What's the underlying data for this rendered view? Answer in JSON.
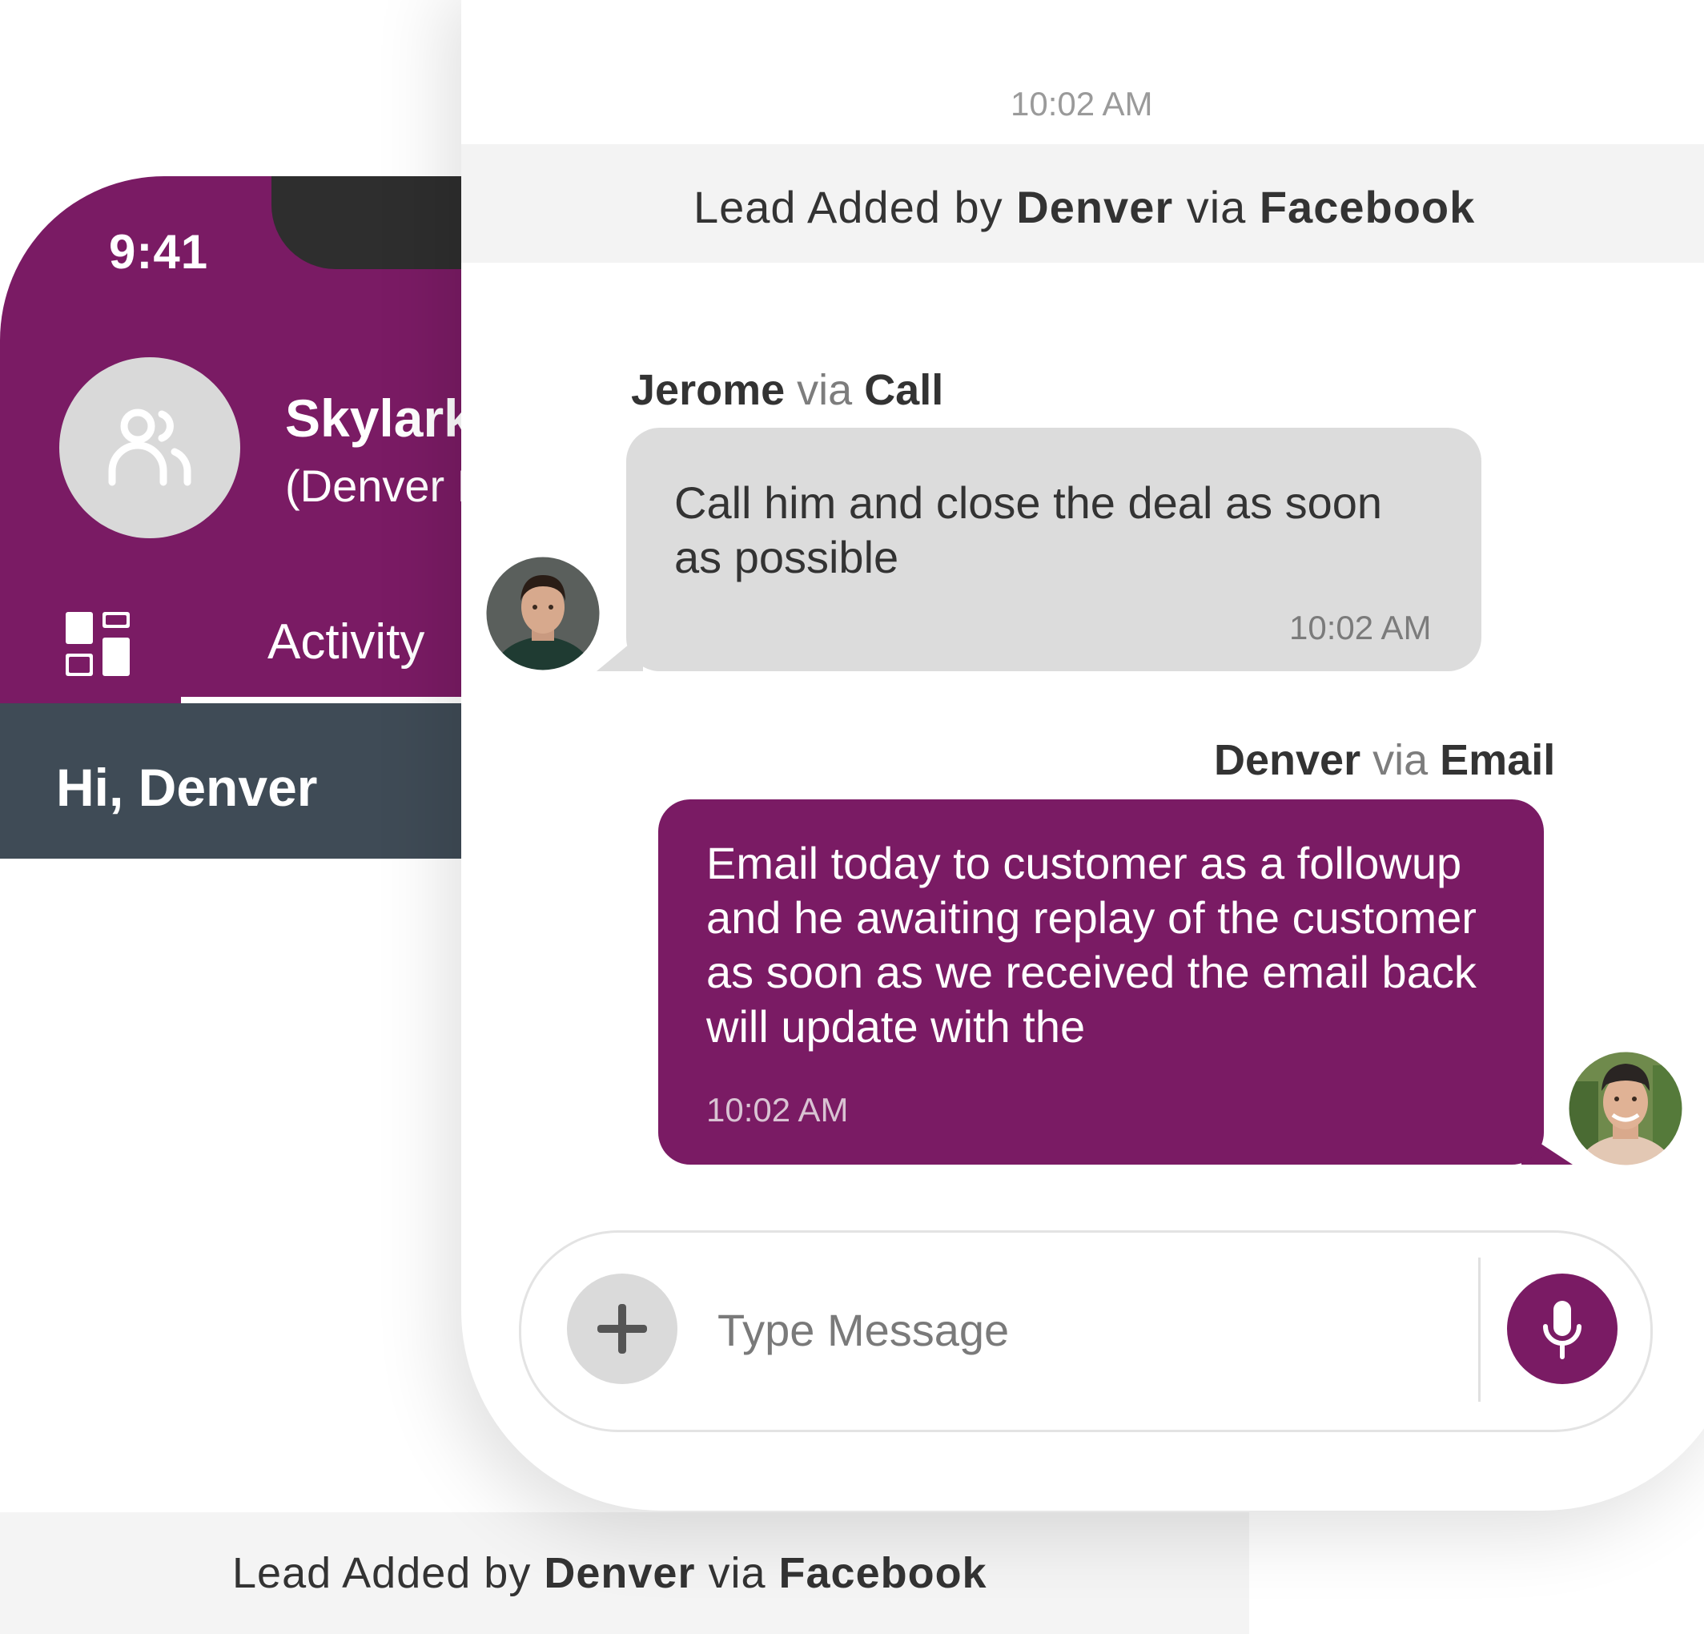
{
  "phone": {
    "status_time": "9:41",
    "contact_name": "Skylark",
    "contact_sub": "(Denver D",
    "tab_activity": "Activity",
    "greeting": "Hi, Denver"
  },
  "bottom_banner": {
    "prefix": "Lead Added by",
    "actor": "Denver",
    "via": "via",
    "source": "Facebook"
  },
  "chat": {
    "top_time": "10:02 AM",
    "lead_banner": {
      "prefix": "Lead Added by",
      "actor": "Denver",
      "via": "via",
      "source": "Facebook"
    },
    "messages": [
      {
        "sender": "Jerome",
        "via": "via",
        "channel": "Call",
        "text": "Call him and close the deal as soon as possible",
        "time": "10:02 AM"
      },
      {
        "sender": "Denver",
        "via": "via",
        "channel": "Email",
        "text": "Email today to customer as a followup and he awaiting replay of the customer as soon as we received the email back will update with the",
        "time": "10:02 AM"
      }
    ],
    "composer": {
      "placeholder": "Type Message"
    }
  },
  "icons": {
    "contact_avatar": "group-user-icon",
    "dashboard": "dashboard-icon",
    "add": "plus-icon",
    "voice": "microphone-icon"
  },
  "colors": {
    "brand": "#7a1b64",
    "greeting_bar": "#3f4b56",
    "incoming_bubble": "#dcdcdc",
    "banner": "#f3f3f3"
  }
}
